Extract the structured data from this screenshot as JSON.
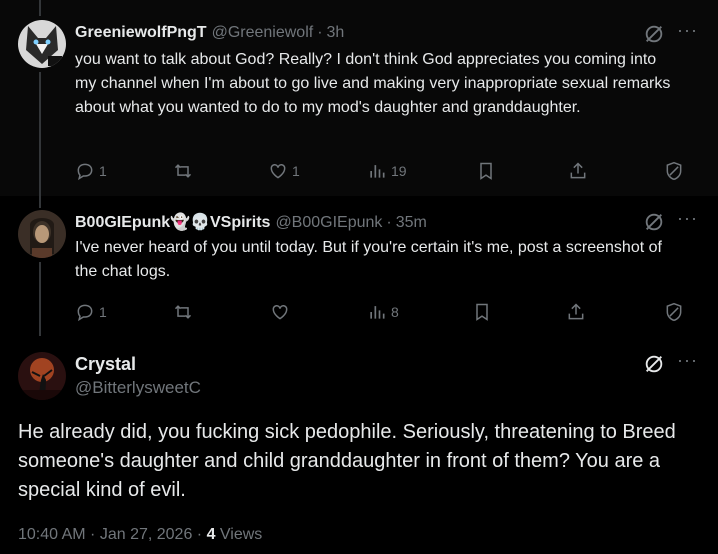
{
  "reply1": {
    "name": "GreeniewolfPngT",
    "handle": "@Greeniewolf",
    "time": "3h",
    "text": "you want to talk about God?  Really?  I don't think God appreciates you coming into my channel when I'm about to go live and making very inappropriate sexual remarks about what you wanted to do to my mod's daughter and granddaughter.",
    "replies": "1",
    "reposts": "",
    "likes": "1",
    "views": "19"
  },
  "reply2": {
    "name": "B00GIEpunk👻💀VSpirits",
    "handle": "@B00GIEpunk",
    "time": "35m",
    "text": "I've never heard of you until today. But if you're certain it's me, post a screenshot of the chat logs.",
    "replies": "1",
    "reposts": "",
    "likes": "",
    "views": "8"
  },
  "main": {
    "name": "Crystal",
    "handle": "@BitterlysweetC",
    "text": "He already did, you fucking sick pedophile.  Seriously, threatening to Breed someone's daughter and child granddaughter in front of them? You are a special kind of evil.",
    "time": "10:40 AM · Jan 27, 2026 · ",
    "views_count": "4",
    "views_label": " Views"
  },
  "separator": "·",
  "icons": [
    "grok-icon",
    "more-icon",
    "reply-icon",
    "repost-icon",
    "like-icon",
    "views-icon",
    "bookmark-icon",
    "share-icon",
    "shield-icon"
  ],
  "colors": {
    "background": "#000000",
    "text": "#e7e9ea",
    "secondary": "#71767b",
    "line": "#333639"
  }
}
